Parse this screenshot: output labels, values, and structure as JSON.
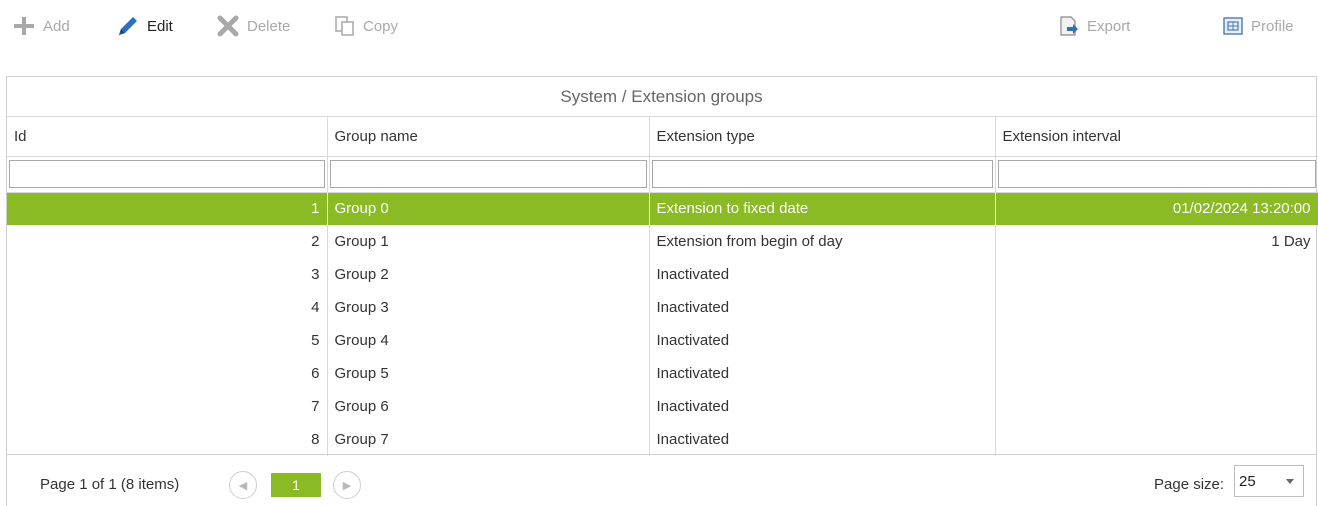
{
  "toolbar": {
    "add_label": "Add",
    "edit_label": "Edit",
    "delete_label": "Delete",
    "copy_label": "Copy",
    "export_label": "Export",
    "profile_label": "Profile"
  },
  "grid": {
    "title": "System / Extension groups",
    "columns": [
      "Id",
      "Group name",
      "Extension type",
      "Extension interval"
    ],
    "filters": [
      "",
      "",
      "",
      ""
    ],
    "rows": [
      {
        "id": "1",
        "name": "Group 0",
        "type": "Extension to fixed date",
        "interval": "01/02/2024 13:20:00",
        "selected": true
      },
      {
        "id": "2",
        "name": "Group 1",
        "type": "Extension from begin of day",
        "interval": "1 Day",
        "selected": false
      },
      {
        "id": "3",
        "name": "Group 2",
        "type": "Inactivated",
        "interval": "",
        "selected": false
      },
      {
        "id": "4",
        "name": "Group 3",
        "type": "Inactivated",
        "interval": "",
        "selected": false
      },
      {
        "id": "5",
        "name": "Group 4",
        "type": "Inactivated",
        "interval": "",
        "selected": false
      },
      {
        "id": "6",
        "name": "Group 5",
        "type": "Inactivated",
        "interval": "",
        "selected": false
      },
      {
        "id": "7",
        "name": "Group 6",
        "type": "Inactivated",
        "interval": "",
        "selected": false
      },
      {
        "id": "8",
        "name": "Group 7",
        "type": "Inactivated",
        "interval": "",
        "selected": false
      }
    ]
  },
  "pager": {
    "info": "Page 1 of 1 (8 items)",
    "current_page": "1",
    "page_size_label": "Page size:",
    "page_size_value": "25"
  },
  "colors": {
    "accent": "#8aba24",
    "disabled_text": "#a9a9a9",
    "border": "#cfcfcf"
  },
  "icons": {
    "add": "plus-icon",
    "edit": "pencil-icon",
    "delete": "x-icon",
    "copy": "copy-icon",
    "export": "export-icon",
    "profile": "profile-icon",
    "prev": "chevron-left-icon",
    "next": "chevron-right-icon"
  }
}
